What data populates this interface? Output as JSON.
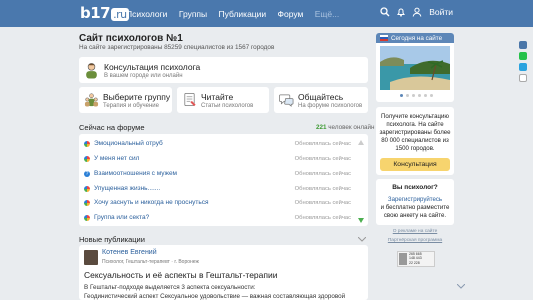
{
  "header": {
    "logo_main": "b17",
    "logo_tld": ".ru",
    "nav": [
      "Психологи",
      "Группы",
      "Публикации",
      "Форум",
      "Ещё..."
    ],
    "login": "Войти",
    "icons": [
      "search-icon",
      "bell-icon",
      "user-icon"
    ]
  },
  "page": {
    "title": "Сайт психологов №1",
    "subtitle": "На сайте зарегистрированы 85259 специалистов из 1567 городов"
  },
  "consult_banner": {
    "title": "Консультация психолога",
    "subtitle": "В вашем городе или онлайн"
  },
  "actions": [
    {
      "title": "Выберите группу",
      "subtitle": "Терапия и обучение"
    },
    {
      "title": "Читайте",
      "subtitle": "Статьи психологов"
    },
    {
      "title": "Общайтесь",
      "subtitle": "На форуме психологов"
    }
  ],
  "forum": {
    "title": "Сейчас на форуме",
    "online_count": "221",
    "online_label": "человек онлайн",
    "update_label": "Обновлялась сейчас",
    "threads": [
      "Эмоциональный отруб",
      "У меня нет сил",
      "Взаимоотношения с мужем",
      "Упущенная жизнь.......",
      "Хочу заснуть и никогда не проснуться",
      "Группа или секта?"
    ]
  },
  "publications": {
    "title": "Новые публикации",
    "author": "Котенев Евгений",
    "author_meta": "Психолог, Гештальт-терапевт · г. Воронеж",
    "article_title": "Сексуальность и её аспекты в Гештальт-терапии",
    "excerpt_1": "В Гештальт-подходе выделяется 3 аспекта сексуальности:",
    "excerpt_2": "Геодинистический аспект Сексуальное удовольствие — важная составляющая здоровой"
  },
  "sidebar": {
    "today_title": "Сегодня на сайте",
    "consult_text": "Получите консультацию психолога. На сайте зарегистрированы более 80 000 специалистов из 1500 городов.",
    "consult_button": "Консультация",
    "psy_title": "Вы психолог?",
    "psy_link": "Зарегистрируйтесь",
    "psy_text": "и бесплатно разместите свою анкету на сайте.",
    "link_about": "О рекламе на сайте",
    "link_terms": "Партнёрская программа",
    "counter_lines": [
      "265 665",
      "148 443",
      "22 228"
    ]
  },
  "colors": {
    "header": "#4a78ad",
    "accent_link": "#2a5f9c",
    "online_green": "#3e9b34",
    "button_yellow": "#f7d46e"
  }
}
